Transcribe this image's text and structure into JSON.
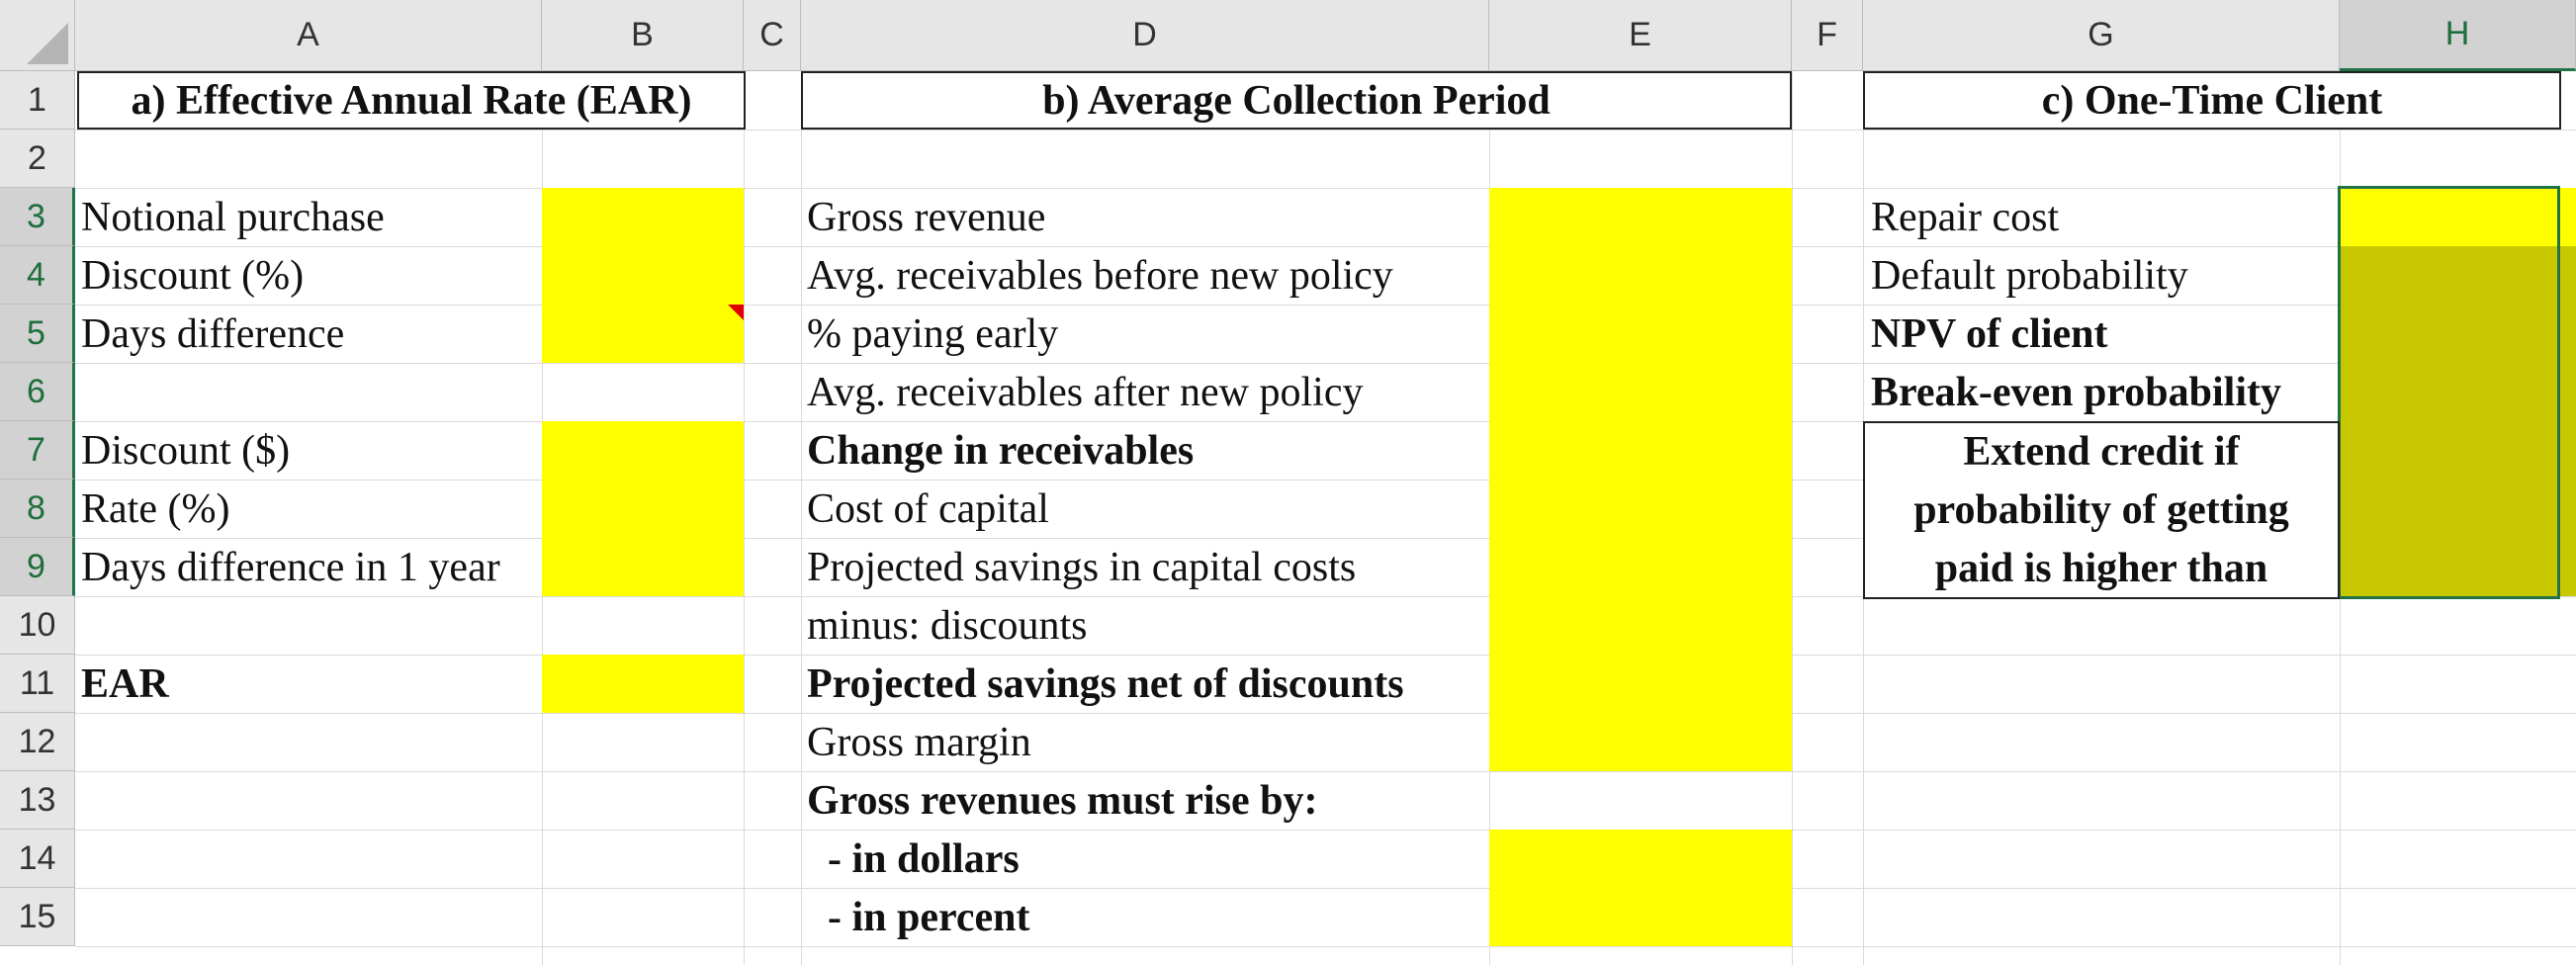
{
  "columns": [
    "A",
    "B",
    "C",
    "D",
    "E",
    "F",
    "G",
    "H"
  ],
  "rows": [
    "1",
    "2",
    "3",
    "4",
    "5",
    "6",
    "7",
    "8",
    "9",
    "10",
    "11",
    "12",
    "13",
    "14",
    "15"
  ],
  "selected_column": "H",
  "selected_rows": [
    "3",
    "4",
    "5",
    "6",
    "7",
    "8",
    "9"
  ],
  "colors": {
    "input_fill": "#ffff00",
    "selected_fill": "#c8c800",
    "selection_border": "#217346",
    "comment_marker": "#e00000"
  },
  "section_a": {
    "title": "a) Effective Annual Rate (EAR)",
    "labels": {
      "r3": "Notional purchase",
      "r4": "Discount (%)",
      "r5": "Days difference",
      "r7": "Discount ($)",
      "r8": "Rate (%)",
      "r9": "Days difference in 1 year",
      "r11": "EAR"
    }
  },
  "section_b": {
    "title": "b) Average Collection Period",
    "labels": {
      "r3": "Gross revenue",
      "r4": "Avg. receivables before new policy",
      "r5": "% paying early",
      "r6": "Avg. receivables after new policy",
      "r7": "Change in receivables",
      "r8": "Cost of capital",
      "r9": "Projected savings in capital costs",
      "r10": "minus: discounts",
      "r11": "Projected savings net of discounts",
      "r12": "Gross margin",
      "r13": "Gross revenues must rise by:",
      "r14": "  - in dollars",
      "r15": "  - in percent"
    }
  },
  "section_c": {
    "title": "c) One-Time Client",
    "labels": {
      "r3": "Repair cost",
      "r4": "Default probability",
      "r5": "NPV of client",
      "r6": "Break-even probability"
    },
    "note_lines": [
      "Extend credit if",
      "probability of getting",
      "paid is higher than"
    ]
  }
}
